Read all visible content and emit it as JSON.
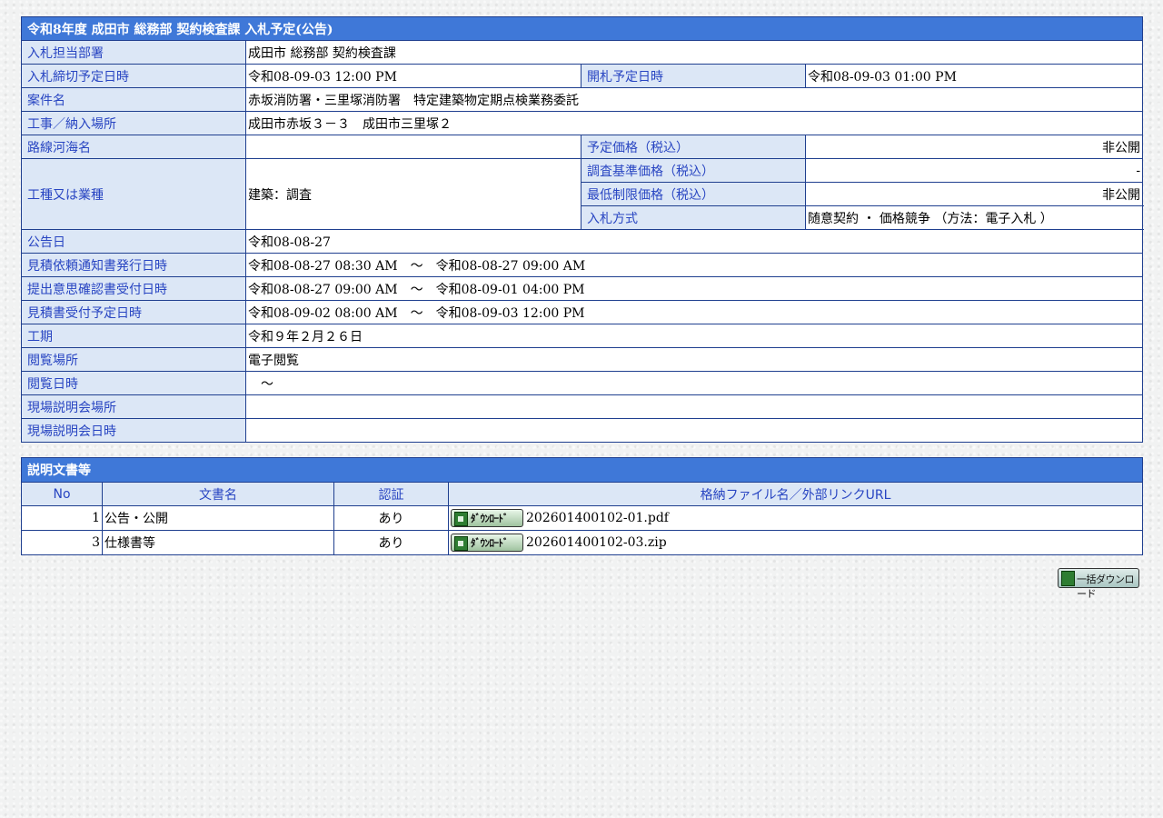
{
  "title": "令和8年度 成田市 総務部 契約検査課 入札予定(公告)",
  "info": {
    "dept_label": "入札担当部署",
    "dept_value": "成田市 総務部 契約検査課",
    "deadline_label": "入札締切予定日時",
    "deadline_value": "令和08-09-03 12:00 PM",
    "opening_label": "開札予定日時",
    "opening_value": "令和08-09-03 01:00 PM",
    "project_label": "案件名",
    "project_value": "赤坂消防署・三里塚消防署　特定建築物定期点検業務委託",
    "location_label": "工事／納入場所",
    "location_value": "成田市赤坂３－３　成田市三里塚２",
    "route_label": "路線河海名",
    "route_value": "",
    "planned_price_label": "予定価格（税込）",
    "planned_price_value": "非公開",
    "category_label": "工種又は業種",
    "category_value": "建築：調査",
    "survey_price_label": "調査基準価格（税込）",
    "survey_price_value": "-",
    "min_price_label": "最低制限価格（税込）",
    "min_price_value": "非公開",
    "method_label": "入札方式",
    "method_value": "随意契約 ・ 価格競争 （方法：電子入札 ）",
    "notice_label": "公告日",
    "notice_value": "令和08-08-27",
    "estimate_issue_label": "見積依頼通知書発行日時",
    "estimate_issue_value": "令和08-08-27 08:30 AM　～　令和08-08-27 09:00 AM",
    "intent_label": "提出意思確認書受付日時",
    "intent_value": "令和08-08-27 09:00 AM　～　令和08-09-01 04:00 PM",
    "estimate_recv_label": "見積書受付予定日時",
    "estimate_recv_value": "令和08-09-02 08:00 AM　～　令和08-09-03 12:00 PM",
    "period_label": "工期",
    "period_value": "令和９年２月２６日",
    "viewing_place_label": "閲覧場所",
    "viewing_place_value": "電子閲覧",
    "viewing_date_label": "閲覧日時",
    "viewing_date_value": "　～",
    "site_place_label": "現場説明会場所",
    "site_place_value": "",
    "site_date_label": "現場説明会日時",
    "site_date_value": ""
  },
  "docs": {
    "title": "説明文書等",
    "headers": {
      "no": "No",
      "name": "文書名",
      "auth": "認証",
      "file": "格納ファイル名／外部リンクURL"
    },
    "download_label": "ﾀﾞｳﾝﾛｰﾄﾞ",
    "rows": [
      {
        "no": "1",
        "name": "公告・公開",
        "auth": "あり",
        "file": "202601400102-01.pdf"
      },
      {
        "no": "3",
        "name": "仕様書等",
        "auth": "あり",
        "file": "202601400102-03.zip"
      }
    ]
  },
  "bulk_download_label": "一括ダウンロード"
}
